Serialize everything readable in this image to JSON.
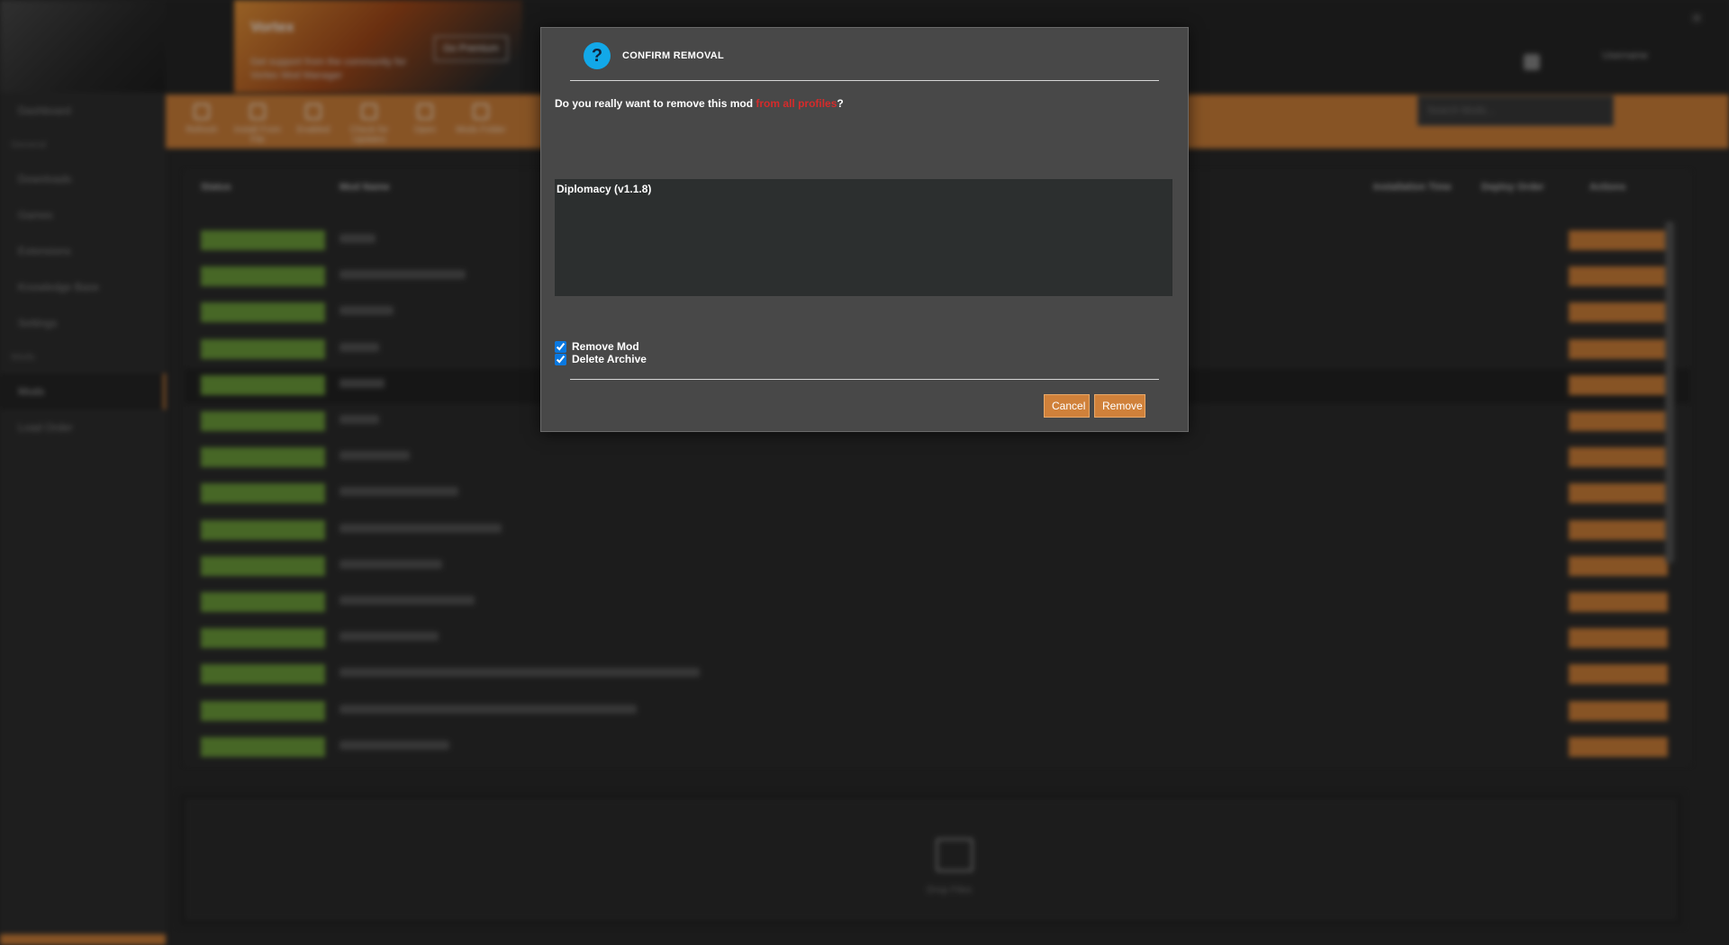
{
  "sidebar": {
    "items": [
      "Dashboard",
      "Downloads",
      "Games",
      "Extensions",
      "Knowledge Base",
      "Settings",
      "Mods",
      "Load Order"
    ],
    "sections": [
      "General",
      "Mods"
    ]
  },
  "topbar": {
    "banner_title": "Vortex",
    "banner_sub": "Get support from the community for Vortex Mod Manager",
    "banner_button": "Go Premium",
    "profile_name": "Username"
  },
  "toolbar": {
    "buttons": [
      "Refresh",
      "Install From File",
      "Enabled",
      "Check for Updates",
      "Open",
      "Mods Folder"
    ],
    "filter_placeholder": "Search Mods..."
  },
  "modlist": {
    "columns": [
      "Status",
      "Mod Name",
      "Installation Time",
      "Deploy Order",
      "Actions"
    ],
    "row_count": 15
  },
  "dropzone": {
    "label": "Drop Files"
  },
  "dialog": {
    "title": "Confirm Removal",
    "icon": "question-icon",
    "question_prefix": "Do you really want to remove this mod ",
    "question_highlight": "from all profiles",
    "question_suffix": "?",
    "mods": [
      "Diplomacy (v1.1.8)"
    ],
    "checkboxes": [
      {
        "label": "Remove Mod",
        "checked": true
      },
      {
        "label": "Delete Archive",
        "checked": true
      }
    ],
    "cancel_label": "Cancel",
    "remove_label": "Remove"
  },
  "colors": {
    "accent": "#d0813a",
    "question_icon": "#12a8e8",
    "highlight_red": "#d62b2b",
    "status_enabled": "#6d9e3b"
  }
}
